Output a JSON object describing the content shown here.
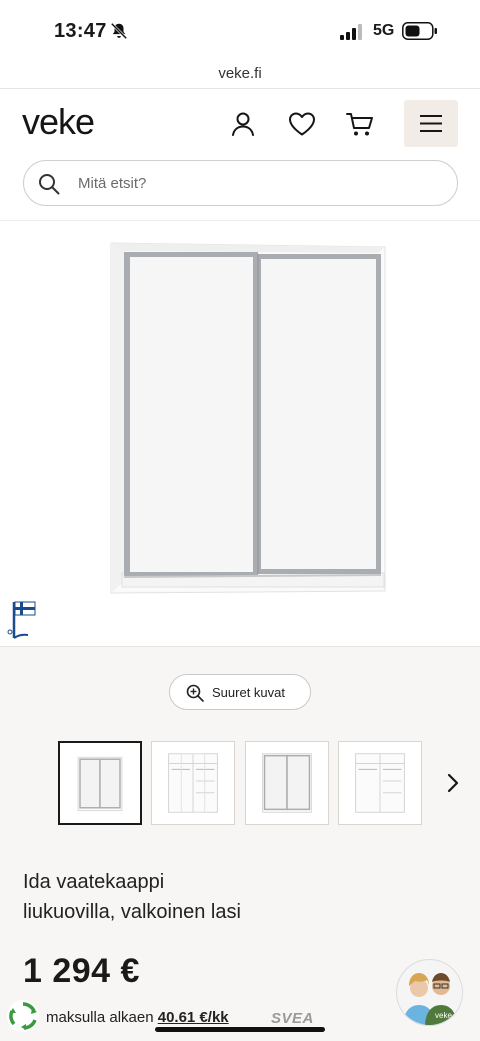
{
  "status_bar": {
    "time": "13:47",
    "network": "5G",
    "icons": [
      "bell-slash-icon",
      "signal-bars-icon",
      "battery-icon"
    ]
  },
  "browser": {
    "url": "veke.fi"
  },
  "header": {
    "logo_text": "veke",
    "icons": [
      "user-icon",
      "heart-icon",
      "cart-icon",
      "menu-icon"
    ]
  },
  "search": {
    "placeholder": "Mitä etsit?"
  },
  "gallery": {
    "big_images_label": "Suuret kuvat",
    "thumbnails": [
      {
        "kind": "doors-closed",
        "selected": true
      },
      {
        "kind": "interior-open",
        "selected": false
      },
      {
        "kind": "doors-closed",
        "selected": false
      },
      {
        "kind": "interior-open",
        "selected": false
      }
    ],
    "next_icon": "chevron-right-icon"
  },
  "product": {
    "title_line1": "Ida vaatekaappi",
    "title_line2": "liukuovilla, valkoinen lasi",
    "price": "1 294 €"
  },
  "financing": {
    "prefix": "maksulla alkaen",
    "amount": "40.61 €/kk",
    "provider": "SVEA"
  },
  "colors": {
    "menu_bg": "#f1ede6",
    "gray_section": "#f7f6f4",
    "flag_blue": "#1a4b8e"
  }
}
